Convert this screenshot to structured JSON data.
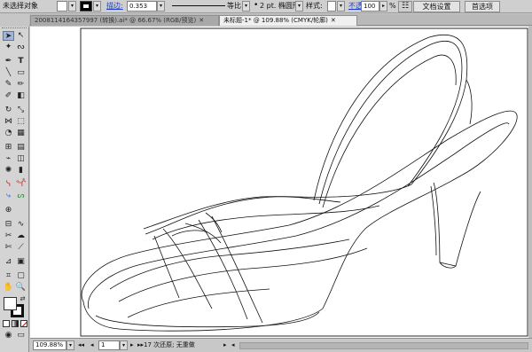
{
  "control_bar": {
    "selection_label": "未选择对象",
    "stroke_label": "描边:",
    "stroke_value": "0.353",
    "profile_label": "等比",
    "brush_label": "2 pt. 椭圆形",
    "style_label": "样式:",
    "opacity_label": "不透明度:",
    "opacity_value": "100",
    "percent_sign": "%",
    "doc_setup_button": "文档设置",
    "preferences_button": "首选项"
  },
  "tabs": [
    {
      "label": "20081141643579​97 (转换).ai* @ 66.67% (RGB/预览)",
      "active": false
    },
    {
      "label": "未标题-1* @ 109.88% (CMYK/轮廓)",
      "active": true
    }
  ],
  "status_bar": {
    "zoom": "109.88%",
    "page": "1",
    "message": "17 次还原; 无重做"
  },
  "icons": {
    "selection": "selection-tool-icon",
    "direct_selection": "direct-selection-tool-icon",
    "pen": "pen-tool-icon",
    "type": "type-tool-icon",
    "zoom": "zoom-tool-icon",
    "hand": "hand-tool-icon"
  }
}
